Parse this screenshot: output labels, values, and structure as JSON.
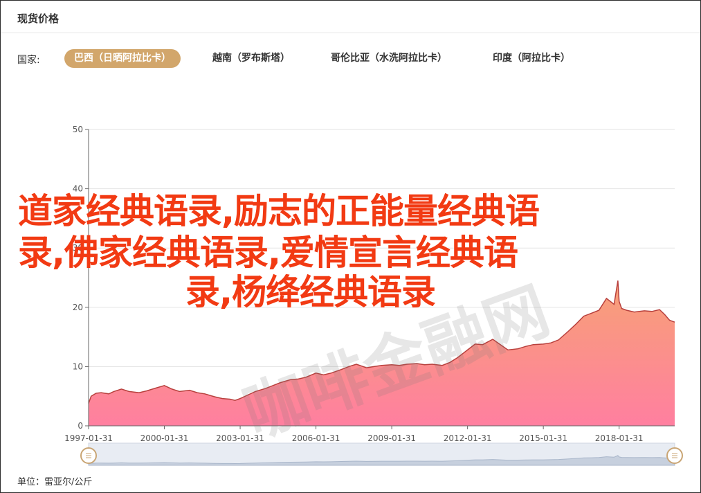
{
  "header": {
    "title": "现货价格"
  },
  "country": {
    "label": "国家:",
    "tabs": [
      {
        "label": "巴西（日晒阿拉比卡）",
        "active": true
      },
      {
        "label": "越南（罗布斯塔）",
        "active": false
      },
      {
        "label": "哥伦比亚（水洗阿拉比卡）",
        "active": false
      },
      {
        "label": "印度（阿拉比卡）",
        "active": false
      }
    ]
  },
  "overlay": {
    "line1": "道家经典语录,励志的正能量经典语",
    "line2": "录,佛家经典语录,爱情宣言经典语",
    "line3": "录,杨绛经典语录"
  },
  "watermark": "咖啡金融网",
  "footer": {
    "unit": "单位：雷亚尔/公斤"
  },
  "colors": {
    "accent": "#d2a66b",
    "line": "#b8403d",
    "area_top": "#f7a176",
    "area_bottom": "#ff7fa0",
    "overlay_text": "#f23a13"
  },
  "chart_data": {
    "type": "area",
    "xlabel": "",
    "ylabel": "",
    "ylim": [
      0,
      50
    ],
    "yticks": [
      0,
      10,
      20,
      30,
      40,
      50
    ],
    "grid": true,
    "x_start": 1997.0,
    "x_end": 2020.2,
    "xtick_labels": [
      "1997-01-31",
      "2000-01-31",
      "2003-01-31",
      "2006-01-31",
      "2009-01-31",
      "2012-01-31",
      "2015-01-31",
      "2018-01-31"
    ],
    "xtick_years": [
      1997,
      2000,
      2003,
      2006,
      2009,
      2012,
      2015,
      2018
    ],
    "series": [
      {
        "x": [
          1997.0,
          1997.1,
          1997.3,
          1997.5,
          1997.8,
          1998.0,
          1998.3,
          1998.6,
          1999.0,
          1999.3,
          1999.6,
          2000.0,
          2000.3,
          2000.6,
          2001.0,
          2001.3,
          2001.6,
          2002.0,
          2002.3,
          2002.6,
          2002.8,
          2003.0,
          2003.3,
          2003.6,
          2004.0,
          2004.3,
          2004.6,
          2005.0,
          2005.3,
          2005.6,
          2006.0,
          2006.3,
          2006.6,
          2007.0,
          2007.3,
          2007.6,
          2008.0,
          2008.3,
          2008.6,
          2009.0,
          2009.3,
          2009.6,
          2010.0,
          2010.3,
          2010.6,
          2011.0,
          2011.3,
          2011.6,
          2012.0,
          2012.3,
          2012.6,
          2013.0,
          2013.3,
          2013.6,
          2014.0,
          2014.3,
          2014.6,
          2015.0,
          2015.3,
          2015.6,
          2016.0,
          2016.3,
          2016.6,
          2016.9,
          2017.2,
          2017.5,
          2017.8,
          2017.95,
          2018.0,
          2018.1,
          2018.3,
          2018.6,
          2019.0,
          2019.3,
          2019.6,
          2019.8,
          2020.0,
          2020.2
        ],
        "y": [
          3.8,
          5.0,
          5.5,
          5.6,
          5.4,
          5.8,
          6.2,
          5.8,
          5.6,
          5.9,
          6.3,
          6.8,
          6.2,
          5.8,
          6.0,
          5.6,
          5.4,
          4.9,
          4.6,
          4.5,
          4.3,
          4.6,
          5.2,
          5.8,
          6.3,
          6.8,
          7.3,
          7.8,
          7.9,
          8.2,
          8.9,
          8.6,
          8.9,
          9.5,
          10.0,
          10.4,
          9.8,
          10.0,
          10.2,
          10.3,
          10.2,
          10.4,
          10.5,
          10.3,
          10.4,
          10.2,
          10.7,
          11.5,
          12.8,
          13.8,
          13.7,
          14.6,
          13.7,
          12.8,
          13.0,
          13.4,
          13.7,
          13.8,
          14.0,
          14.5,
          16.0,
          17.2,
          18.5,
          19.0,
          19.5,
          21.5,
          20.5,
          24.5,
          21.0,
          19.8,
          19.5,
          19.2,
          19.4,
          19.3,
          19.6,
          18.8,
          17.8,
          17.5
        ]
      }
    ]
  },
  "zoom_slider": {
    "start_percent": 0,
    "end_percent": 100
  }
}
